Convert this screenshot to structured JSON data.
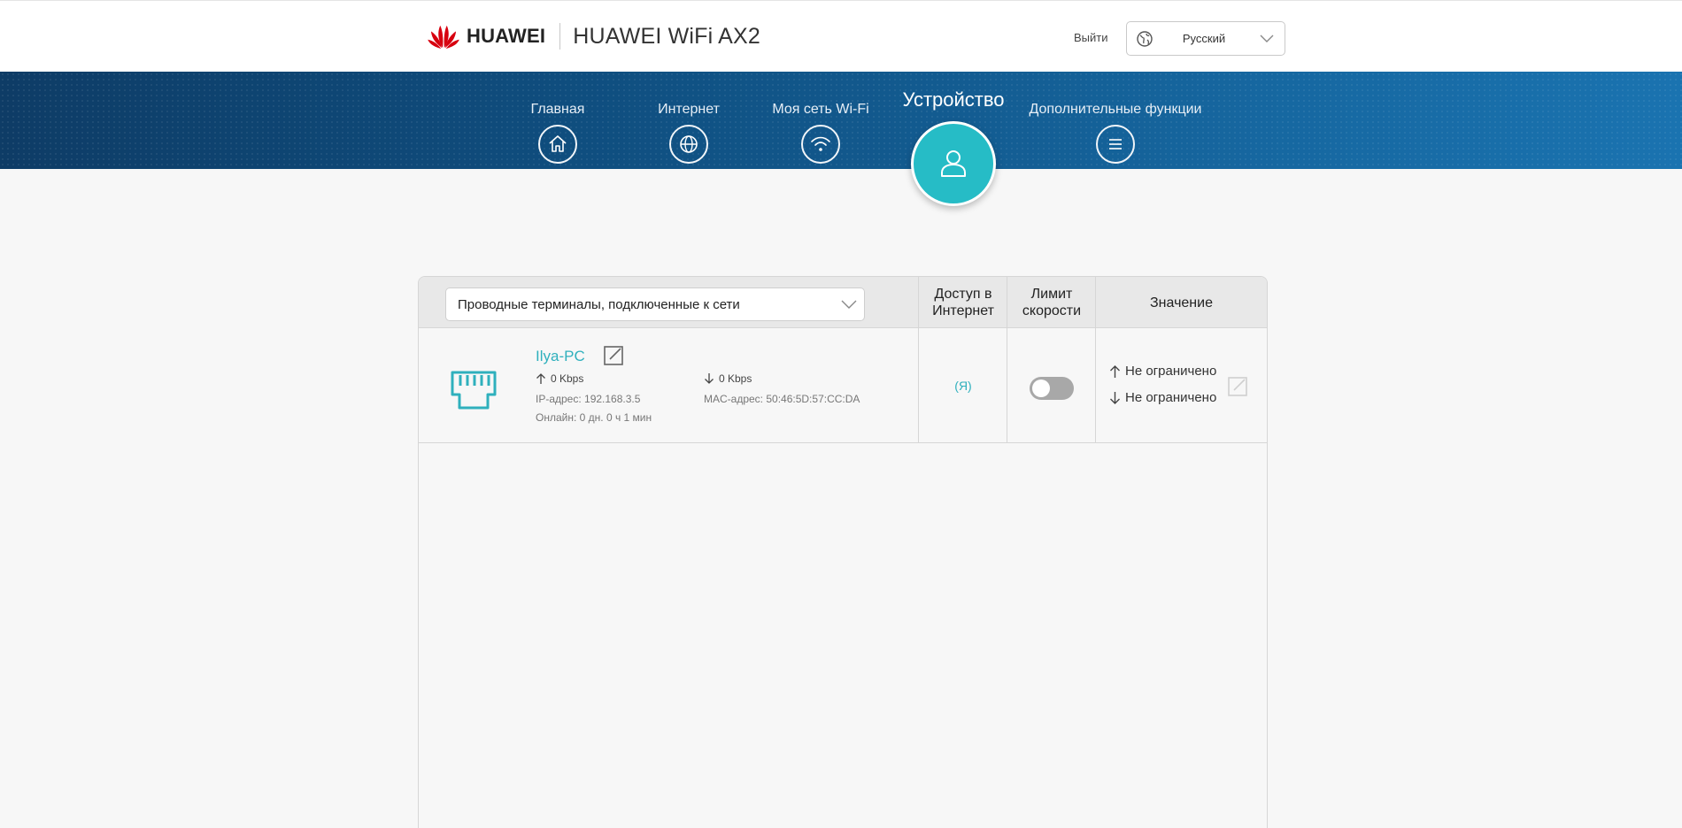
{
  "header": {
    "brand": "HUAWEI",
    "product": "HUAWEI WiFi AX2",
    "logout_label": "Выйти",
    "language": {
      "selected": "Русский",
      "icon": "globe-icon"
    }
  },
  "nav": {
    "items": [
      {
        "label": "Главная",
        "icon": "home-icon",
        "active": false
      },
      {
        "label": "Интернет",
        "icon": "globe-icon",
        "active": false
      },
      {
        "label": "Моя сеть Wi-Fi",
        "icon": "wifi-icon",
        "active": false
      },
      {
        "label": "Устройство",
        "icon": "user-icon",
        "active": true
      },
      {
        "label": "Дополнительные функции",
        "icon": "menu-icon",
        "active": false
      }
    ]
  },
  "table": {
    "filter": {
      "selected": "Проводные терминалы, подключенные к сети"
    },
    "columns": {
      "access": "Доступ в Интернет",
      "speed_limit": "Лимит скорости",
      "value": "Значение"
    },
    "rows": [
      {
        "name": "Ilya-PC",
        "icon": "ethernet-port-icon",
        "upload": "0 Kbps",
        "download": "0 Kbps",
        "ip": "IP-адрес: 192.168.3.5",
        "mac": "MAC-адрес: 50:46:5D:57:CC:DA",
        "online": "Онлайн: 0 дн. 0 ч 1 мин",
        "access": "(Я)",
        "speed_limit_enabled": false,
        "limit_up": "Не ограничено",
        "limit_down": "Не ограничено"
      }
    ]
  },
  "colors": {
    "accent": "#26bcc6",
    "link": "#2fb0bd",
    "nav_dark": "#0e3c66",
    "nav_light": "#1a73b0"
  }
}
